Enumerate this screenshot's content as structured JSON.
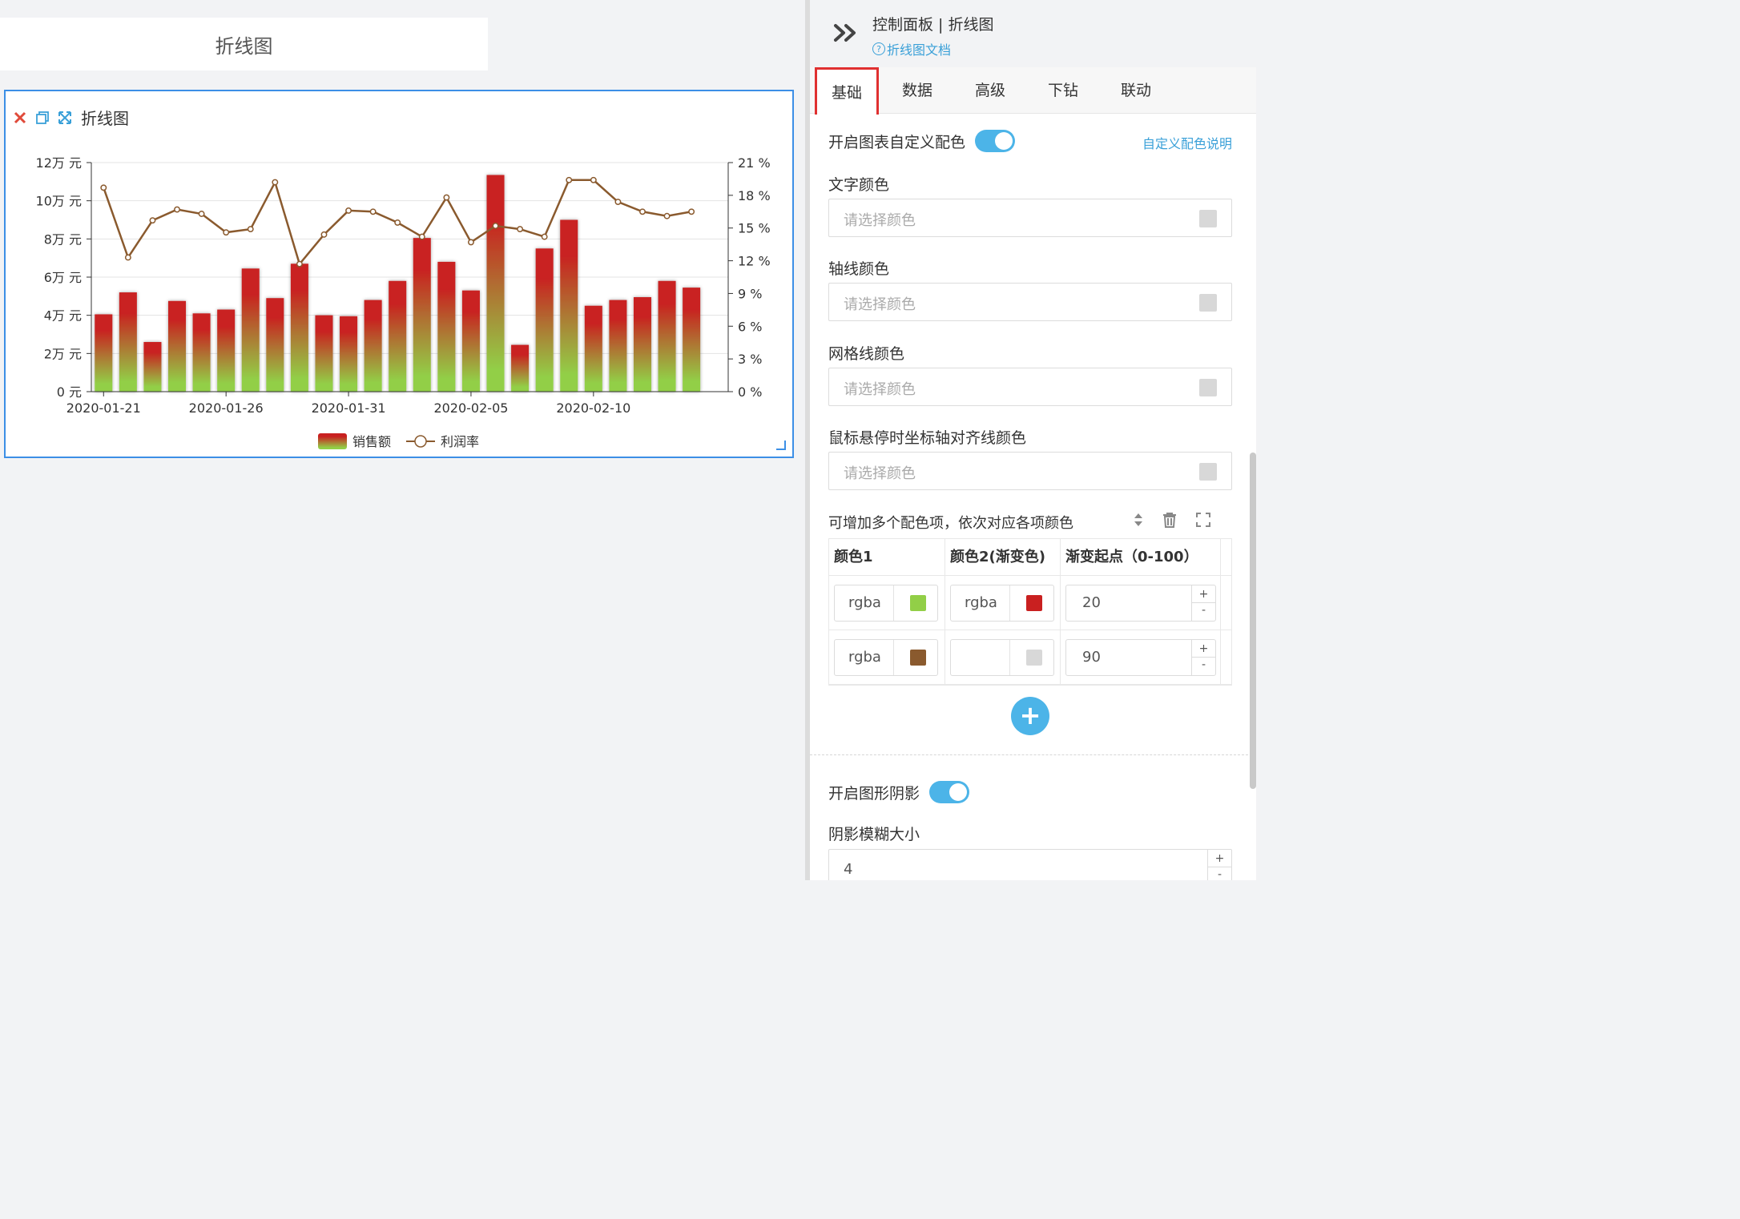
{
  "canvas": {
    "top_card_title": "折线图",
    "widget_title": "折线图"
  },
  "panel": {
    "title": "控制面板 | 折线图",
    "doc_link": "折线图文档",
    "tabs": [
      "基础",
      "数据",
      "高级",
      "下钻",
      "联动"
    ],
    "active_tab": "基础",
    "custom_color_toggle_label": "开启图表自定义配色",
    "custom_color_help_link": "自定义配色说明",
    "text_color_label": "文字颜色",
    "axis_color_label": "轴线颜色",
    "grid_color_label": "网格线颜色",
    "hover_axis_color_label": "鼠标悬停时坐标轴对齐线颜色",
    "color_placeholder": "请选择颜色",
    "palette_hint": "可增加多个配色项，依次对应各项颜色",
    "palette_columns": [
      "颜色1",
      "颜色2(渐变色)",
      "渐变起点（0-100）"
    ],
    "palette_rows": [
      {
        "color1_text": "rgba",
        "color1": "#92cf47",
        "color2_text": "rgba",
        "color2": "#c92020",
        "start": "20"
      },
      {
        "color1_text": "rgba",
        "color1": "#8a5a2e",
        "color2_text": "",
        "color2": "#d8d8d8",
        "start": "90"
      }
    ],
    "shadow_toggle_label": "开启图形阴影",
    "shadow_blur_label": "阴影模糊大小",
    "shadow_blur_value": "4",
    "stepper_plus": "+",
    "stepper_minus": "-",
    "add_symbol": "+"
  },
  "colors": {
    "accent": "#4cb4e8",
    "link": "#3aa0d8",
    "active_tab_border": "#e03030",
    "selection_border": "#3c8fe6"
  },
  "icons": {
    "widget_close": "close-icon",
    "widget_copy": "copy-icon",
    "widget_fullscreen": "expand-icon",
    "panel_collapse": "double-chevron-right-icon",
    "palette_sort": "sort-icon",
    "palette_delete": "trash-icon",
    "palette_fullscreen": "fullscreen-icon"
  },
  "chart_data": {
    "type": "bar",
    "title": "折线图",
    "categories": [
      "2020-01-21",
      "2020-01-22",
      "2020-01-23",
      "2020-01-24",
      "2020-01-25",
      "2020-01-26",
      "2020-01-27",
      "2020-01-28",
      "2020-01-29",
      "2020-01-30",
      "2020-01-31",
      "2020-02-01",
      "2020-02-02",
      "2020-02-03",
      "2020-02-04",
      "2020-02-05",
      "2020-02-06",
      "2020-02-07",
      "2020-02-08",
      "2020-02-09",
      "2020-02-10",
      "2020-02-11",
      "2020-02-12",
      "2020-02-13",
      "2020-02-14",
      "2020-02-15"
    ],
    "x_tick_labels": [
      "2020-01-21",
      "2020-01-26",
      "2020-01-31",
      "2020-02-05",
      "2020-02-10"
    ],
    "series": [
      {
        "name": "销售额",
        "type": "bar",
        "axis": "left",
        "values": [
          40500,
          52000,
          26000,
          47500,
          41000,
          43000,
          64500,
          49000,
          67000,
          40000,
          39500,
          48000,
          58000,
          80500,
          68000,
          53000,
          113500,
          24500,
          75000,
          90000,
          45000,
          48000,
          49500,
          58000,
          54500,
          0
        ]
      },
      {
        "name": "利润率",
        "type": "line",
        "axis": "right",
        "values": [
          18.7,
          12.3,
          15.7,
          16.7,
          16.3,
          14.6,
          14.9,
          19.2,
          11.7,
          14.4,
          16.6,
          16.5,
          15.5,
          14.2,
          17.8,
          13.7,
          15.2,
          14.9,
          14.2,
          19.4,
          19.4,
          17.4,
          16.5,
          16.1,
          16.5,
          null
        ]
      }
    ],
    "y_left": {
      "min": 0,
      "max": 120000,
      "ticks": [
        0,
        20000,
        40000,
        60000,
        80000,
        100000,
        120000
      ],
      "tick_labels": [
        "0 元",
        "2万 元",
        "4万 元",
        "6万 元",
        "8万 元",
        "10万 元",
        "12万 元"
      ]
    },
    "y_right": {
      "min": 0,
      "max": 21,
      "ticks": [
        0,
        3,
        6,
        9,
        12,
        15,
        18,
        21
      ],
      "tick_labels": [
        "0 %",
        "3 %",
        "6 %",
        "9 %",
        "12 %",
        "15 %",
        "18 %",
        "21 %"
      ]
    },
    "grid": true,
    "legend": {
      "position": "bottom-center",
      "items": [
        "销售额",
        "利润率"
      ]
    },
    "bar_gradient": {
      "top": "#c92020",
      "bottom": "#92cf47"
    },
    "line_color": "#8a5a2e"
  }
}
